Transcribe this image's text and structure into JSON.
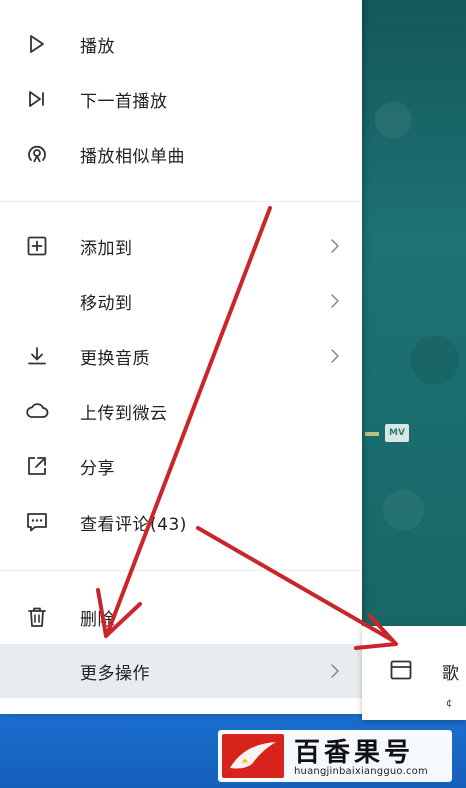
{
  "menu": {
    "items": [
      {
        "label": "播放",
        "icon": "play-icon"
      },
      {
        "label": "下一首播放",
        "icon": "play-next-icon"
      },
      {
        "label": "播放相似单曲",
        "icon": "similar-songs-icon"
      },
      {
        "label": "添加到",
        "icon": "add-square-icon",
        "has_submenu": true
      },
      {
        "label": "移动到",
        "icon": "",
        "has_submenu": true
      },
      {
        "label": "更换音质",
        "icon": "download-icon",
        "has_submenu": true
      },
      {
        "label": "上传到微云",
        "icon": "cloud-icon"
      },
      {
        "label": "分享",
        "icon": "share-icon"
      },
      {
        "label": "查看评论(43)",
        "icon": "comment-icon"
      },
      {
        "label": "删除",
        "icon": "trash-icon"
      },
      {
        "label": "更多操作",
        "icon": "",
        "has_submenu": true,
        "highlighted": true
      }
    ]
  },
  "submenu": {
    "item_label": "歌",
    "extra_mark": "¢"
  },
  "background": {
    "chip_text": "MV"
  },
  "watermark": {
    "name": "百香果号",
    "url": "huangjinbaixiangguo.com"
  },
  "colors": {
    "annotation_arrow": "#c8262a",
    "menu_highlight": "#e9ecef",
    "taskbar": "#1b6fcf",
    "background_teal": "#1d7273"
  }
}
